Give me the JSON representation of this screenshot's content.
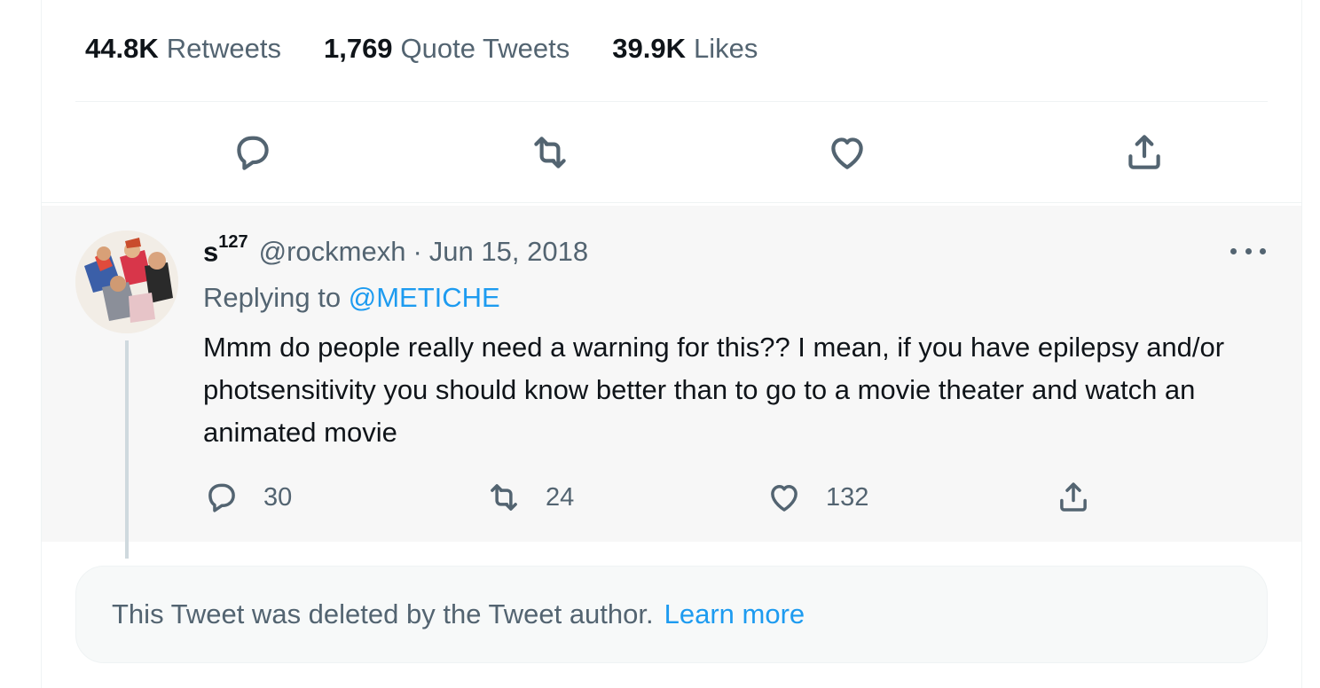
{
  "stats": {
    "retweets": {
      "count": "44.8K",
      "label": "Retweets"
    },
    "quotes": {
      "count": "1,769",
      "label": "Quote Tweets"
    },
    "likes": {
      "count": "39.9K",
      "label": "Likes"
    }
  },
  "main_actions": [
    "reply-icon",
    "retweet-icon",
    "like-icon",
    "share-icon"
  ],
  "reply_tweet": {
    "display_name": "s",
    "display_name_sup": "127",
    "handle": "@rockmexh",
    "separator": "·",
    "date": "Jun 15, 2018",
    "replying_prefix": "Replying to",
    "replying_to": "@METICHE",
    "text": "Mmm do people really need a warning for this?? I mean, if you have epilepsy and/or photsensitivity you should know better than to go to a movie theater and watch an animated movie",
    "reply_count": "30",
    "retweet_count": "24",
    "like_count": "132"
  },
  "deleted_notice": {
    "text": "This Tweet was deleted by the Tweet author.",
    "link": "Learn more"
  },
  "colors": {
    "primary_text": "#0f1419",
    "secondary_text": "#536471",
    "link": "#1d9bf0",
    "reply_bg": "#f7f7f7",
    "thread_line": "#cfd9de"
  }
}
